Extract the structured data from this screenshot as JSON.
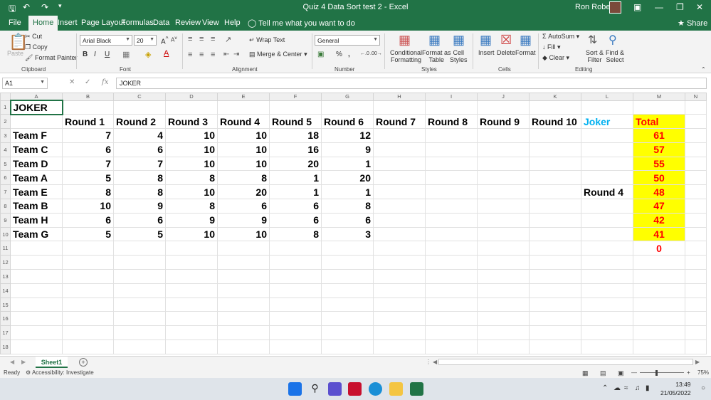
{
  "titlebar": {
    "title": "Quiz 4 Data Sort test 2  -  Excel",
    "user": "Ron Roberts",
    "save_icon": "save-icon",
    "undo_icon": "undo-icon",
    "redo_icon": "redo-icon"
  },
  "tabs": [
    "File",
    "Home",
    "Insert",
    "Page Layout",
    "Formulas",
    "Data",
    "Review",
    "View",
    "Help"
  ],
  "active_tab": "Home",
  "tell_me": "Tell me what you want to do",
  "share": "Share",
  "ribbon": {
    "clipboard": {
      "paste": "Paste",
      "cut": "Cut",
      "copy": "Copy",
      "format_painter": "Format Painter",
      "group": "Clipboard"
    },
    "font": {
      "name": "Arial Black",
      "size": "20",
      "bold": "B",
      "italic": "I",
      "underline": "U",
      "group": "Font",
      "grow": "A",
      "shrink": "A",
      "font_color_letter": "A"
    },
    "alignment": {
      "wrap": "Wrap Text",
      "merge": "Merge & Center",
      "group": "Alignment"
    },
    "number": {
      "format": "General",
      "group": "Number",
      "percent": "%",
      "comma": ","
    },
    "styles": {
      "cond": "Conditional",
      "cond2": "Formatting",
      "table": "Format as",
      "table2": "Table",
      "cell": "Cell",
      "cell2": "Styles",
      "group": "Styles"
    },
    "cells": {
      "insert": "Insert",
      "delete": "Delete",
      "format": "Format",
      "group": "Cells"
    },
    "editing": {
      "autosum": "AutoSum",
      "fill": "Fill",
      "clear": "Clear",
      "sort": "Sort &",
      "sort2": "Filter",
      "find": "Find &",
      "find2": "Select",
      "group": "Editing"
    }
  },
  "formula_bar": {
    "name_box": "A1",
    "formula": "JOKER",
    "fx": "fx"
  },
  "columns": [
    "A",
    "B",
    "C",
    "D",
    "E",
    "F",
    "G",
    "H",
    "I",
    "J",
    "K",
    "L",
    "M",
    "N"
  ],
  "rows": [
    "1",
    "2",
    "3",
    "4",
    "5",
    "6",
    "7",
    "8",
    "9",
    "10",
    "11",
    "12",
    "13",
    "14",
    "15",
    "16",
    "17",
    "18"
  ],
  "cells": {
    "a1": "JOKER",
    "headers": [
      "Round 1",
      "Round 2",
      "Round 3",
      "Round 4",
      "Round 5",
      "Round 6",
      "Round 7",
      "Round 8",
      "Round 9",
      "Round 10"
    ],
    "joker_header": "Joker",
    "total_header": "Total",
    "teams": [
      {
        "name": "Team F",
        "scores": [
          "7",
          "4",
          "10",
          "10",
          "18",
          "12"
        ],
        "joker": "",
        "total": "61"
      },
      {
        "name": "Team C",
        "scores": [
          "6",
          "6",
          "10",
          "10",
          "16",
          "9"
        ],
        "joker": "",
        "total": "57"
      },
      {
        "name": "Team D",
        "scores": [
          "7",
          "7",
          "10",
          "10",
          "20",
          "1"
        ],
        "joker": "",
        "total": "55"
      },
      {
        "name": "Team A",
        "scores": [
          "5",
          "8",
          "8",
          "8",
          "1",
          "20"
        ],
        "joker": "",
        "total": "50"
      },
      {
        "name": "Team E",
        "scores": [
          "8",
          "8",
          "10",
          "20",
          "1",
          "1"
        ],
        "joker": "Round 4",
        "total": "48"
      },
      {
        "name": "Team B",
        "scores": [
          "10",
          "9",
          "8",
          "6",
          "6",
          "8"
        ],
        "joker": "",
        "total": "47"
      },
      {
        "name": "Team H",
        "scores": [
          "6",
          "6",
          "9",
          "9",
          "6",
          "6"
        ],
        "joker": "",
        "total": "42"
      },
      {
        "name": "Team G",
        "scores": [
          "5",
          "5",
          "10",
          "10",
          "8",
          "3"
        ],
        "joker": "",
        "total": "41"
      }
    ],
    "m11": "0"
  },
  "sheet_tab": "Sheet1",
  "status": {
    "ready": "Ready",
    "accessibility": "Accessibility: Investigate",
    "zoom": "75%"
  },
  "taskbar": {
    "time": "13:49",
    "date": "21/05/2022"
  },
  "colors": {
    "excel_green": "#217346",
    "total_fill": "#ffff00",
    "total_text": "#ff0000",
    "joker_text": "#00b0f0"
  }
}
